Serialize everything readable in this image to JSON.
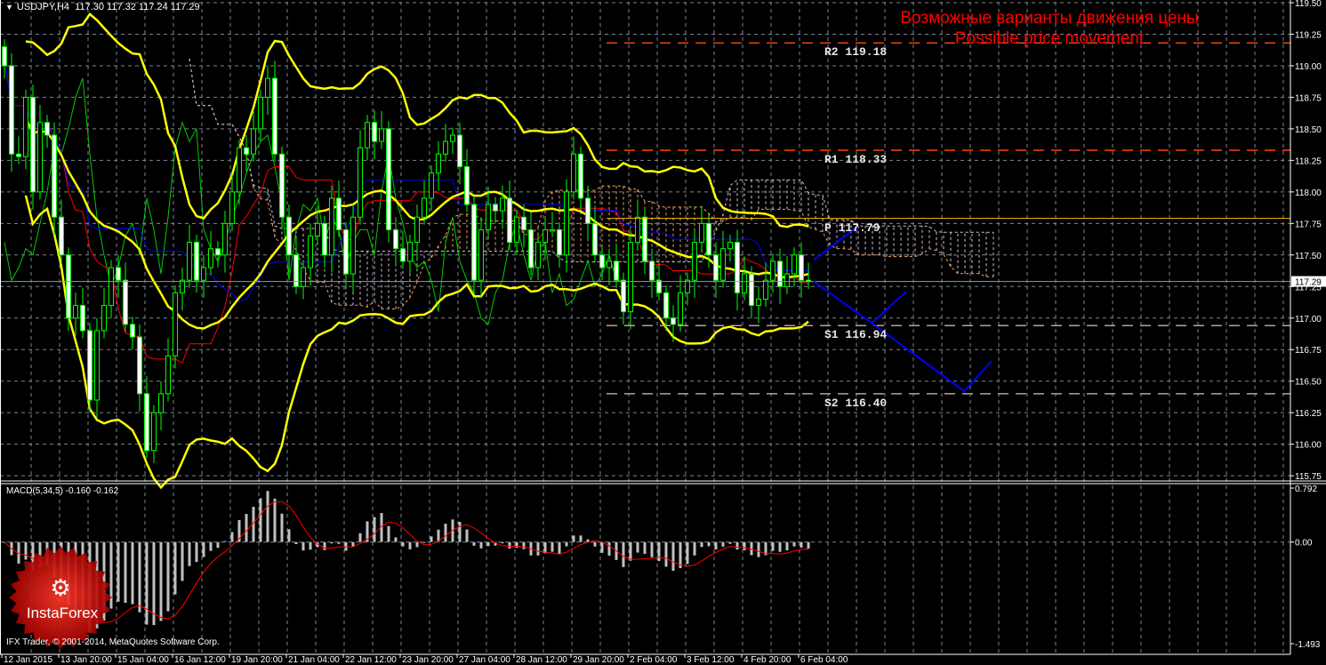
{
  "header": {
    "symbol": "USDJPY,H4",
    "ohlc": "117.30 117.32 117.24 117.29"
  },
  "annotation": {
    "title_ru": "Возможные варианты движения цены",
    "title_en": "Possible price movement"
  },
  "levels": [
    {
      "label": "R2 119.18",
      "value": 119.18,
      "color": "#ff4500",
      "style": "dashed"
    },
    {
      "label": "R1 118.33",
      "value": 118.33,
      "color": "#ff4500",
      "style": "dashed"
    },
    {
      "label": "P 117.79",
      "value": 117.79,
      "color": "#ffc000",
      "style": "solid"
    },
    {
      "label": "S1 116.94",
      "value": 116.94,
      "color": "#c89a90",
      "style": "dashed"
    },
    {
      "label": "S2 116.40",
      "value": 116.4,
      "color": "#c89a90",
      "style": "dashed"
    }
  ],
  "price_axis": {
    "ticks": [
      "119.50",
      "119.25",
      "119.00",
      "118.75",
      "118.50",
      "118.25",
      "118.00",
      "117.75",
      "117.50",
      "117.25",
      "117.00",
      "116.75",
      "116.50",
      "116.25",
      "116.00",
      "115.75"
    ],
    "current": "117.29"
  },
  "macd": {
    "label": "MACD(5,34,5) -0.160 -0.162",
    "ticks": [
      "0.792",
      "0.00",
      "-1.493"
    ],
    "max": 0.792,
    "min": -1.493
  },
  "time_axis": [
    "12 Jan 2015",
    "13 Jan 20:00",
    "15 Jan 04:00",
    "16 Jan 12:00",
    "19 Jan 20:00",
    "21 Jan 04:00",
    "22 Jan 12:00",
    "23 Jan 20:00",
    "27 Jan 04:00",
    "28 Jan 12:00",
    "29 Jan 20:00",
    "2 Feb 04:00",
    "3 Feb 12:00",
    "4 Feb 20:00",
    "6 Feb 04:00"
  ],
  "footer": {
    "copyright": "IFX Trader, © 2001-2014, MetaQuotes Software Corp."
  },
  "logo": {
    "text": "InstaForex"
  },
  "colors": {
    "bull": "#00ff00",
    "bear": "#ffffff",
    "bands": "#ffff00",
    "tenkan": "#ff0000",
    "kijun": "#0000ff",
    "chikou": "#00cc00",
    "projection": "#0000ff",
    "macd_hist": "#c0c0c0",
    "macd_signal": "#ff0000"
  },
  "chart_data": {
    "type": "candlestick",
    "title": "USDJPY,H4",
    "ylim": [
      115.75,
      119.5
    ],
    "first_open": 119.15,
    "close": [
      119.0,
      118.3,
      118.28,
      118.75,
      118.0,
      118.55,
      118.45,
      117.8,
      117.5,
      117.0,
      117.1,
      116.9,
      116.35,
      116.9,
      117.1,
      117.4,
      117.3,
      116.95,
      116.85,
      116.4,
      115.95,
      116.25,
      116.4,
      116.7,
      117.2,
      117.3,
      117.6,
      117.3,
      117.4,
      117.55,
      117.5,
      117.75,
      118.0,
      118.35,
      118.3,
      118.5,
      118.75,
      118.9,
      118.3,
      117.8,
      117.5,
      117.25,
      117.4,
      117.65,
      117.75,
      117.5,
      117.95,
      117.7,
      117.35,
      117.8,
      118.35,
      118.55,
      118.4,
      118.5,
      117.7,
      117.55,
      117.45,
      117.6,
      117.8,
      117.95,
      118.15,
      118.3,
      118.4,
      118.45,
      118.2,
      117.9,
      117.3,
      117.7,
      117.9,
      117.85,
      117.95,
      117.6,
      117.8,
      117.7,
      117.4,
      117.6,
      117.7,
      117.7,
      117.5,
      118.0,
      118.3,
      117.95,
      117.75,
      117.5,
      117.4,
      117.45,
      117.3,
      117.05,
      117.6,
      117.8,
      117.45,
      117.3,
      117.2,
      117.0,
      116.95,
      117.2,
      117.3,
      117.6,
      117.75,
      117.5,
      117.3,
      117.55,
      117.6,
      117.2,
      117.35,
      117.1,
      117.15,
      117.3,
      117.45,
      117.25,
      117.35,
      117.5,
      117.3,
      117.29
    ],
    "indicators": [
      "Bollinger Bands (20,2)",
      "Ichimoku (9,26,52)",
      "MACD(5,34,5)"
    ],
    "projection": [
      [
        [
          113.75,
          117.46
        ],
        [
          119.75,
          117.72
        ]
      ],
      [
        [
          113.75,
          117.29
        ],
        [
          121.9,
          116.96
        ],
        [
          126.75,
          117.21
        ]
      ],
      [
        [
          121.9,
          116.96
        ],
        [
          134.9,
          116.42
        ],
        [
          138.75,
          116.66
        ]
      ]
    ]
  }
}
